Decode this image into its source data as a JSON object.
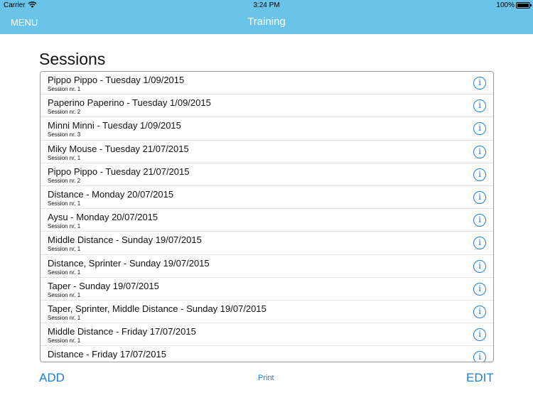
{
  "status_bar": {
    "carrier": "Carrier",
    "time": "3:24 PM",
    "battery": "100%"
  },
  "nav": {
    "menu_label": "MENU",
    "title": "Training"
  },
  "sessions": {
    "heading": "Sessions",
    "items": [
      {
        "title": "Pippo Pippo - Tuesday 1/09/2015",
        "subtitle": "Session nr. 1"
      },
      {
        "title": "Paperino Paperino - Tuesday 1/09/2015",
        "subtitle": "Session nr. 2"
      },
      {
        "title": "Minni Minni - Tuesday 1/09/2015",
        "subtitle": "Session nr. 3"
      },
      {
        "title": "Miky Mouse - Tuesday 21/07/2015",
        "subtitle": "Session nr. 1"
      },
      {
        "title": "Pippo Pippo - Tuesday 21/07/2015",
        "subtitle": "Session nr. 2"
      },
      {
        "title": "Distance - Monday 20/07/2015",
        "subtitle": "Session nr. 1"
      },
      {
        "title": "Aysu - Monday 20/07/2015",
        "subtitle": "Session nr. 1"
      },
      {
        "title": "Middle Distance - Sunday 19/07/2015",
        "subtitle": "Session nr. 1"
      },
      {
        "title": "Distance, Sprinter - Sunday 19/07/2015",
        "subtitle": "Session nr. 1"
      },
      {
        "title": "Taper - Sunday 19/07/2015",
        "subtitle": "Session nr. 1"
      },
      {
        "title": "Taper, Sprinter, Middle Distance - Sunday 19/07/2015",
        "subtitle": "Session nr. 1"
      },
      {
        "title": "Middle Distance - Friday 17/07/2015",
        "subtitle": "Session nr. 1"
      },
      {
        "title": "Distance - Friday 17/07/2015",
        "subtitle": ""
      }
    ],
    "info_glyph": "i"
  },
  "footer": {
    "add_label": "ADD",
    "print_label": "Print",
    "edit_label": "EDIT"
  },
  "colors": {
    "nav_background": "#6ac4ea",
    "accent": "#1a7fd6"
  },
  "icons": {
    "wifi": "wifi-icon",
    "battery": "battery-icon",
    "info": "info-icon"
  }
}
